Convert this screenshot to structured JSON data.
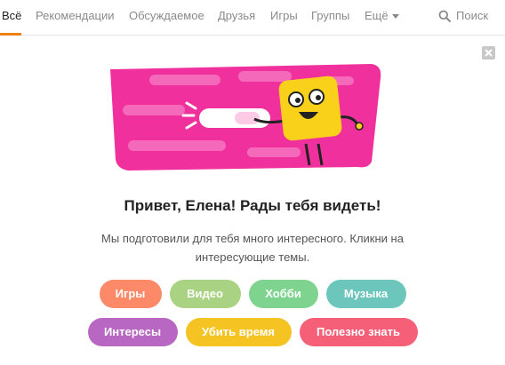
{
  "nav": {
    "tabs": [
      {
        "label": "Всё"
      },
      {
        "label": "Рекомендации"
      },
      {
        "label": "Обсуждаемое"
      },
      {
        "label": "Друзья"
      },
      {
        "label": "Игры"
      },
      {
        "label": "Группы"
      },
      {
        "label": "Ещё"
      }
    ],
    "active_tab": "Всё",
    "accent_color": "#ee8208",
    "search_label": "Поиск"
  },
  "banner": {
    "greeting": "Привет, Елена! Рады тебя видеть!",
    "description": "Мы подготовили для тебя много интересного. Кликни на интересующие темы.",
    "topics_row1": [
      {
        "label": "Игры",
        "color": "#fc8967"
      },
      {
        "label": "Видео",
        "color": "#a9d282"
      },
      {
        "label": "Хобби",
        "color": "#7ed48f"
      },
      {
        "label": "Музыка",
        "color": "#6cc6bb"
      }
    ],
    "topics_row2": [
      {
        "label": "Интересы",
        "color": "#b867c2"
      },
      {
        "label": "Убить время",
        "color": "#f5c423"
      },
      {
        "label": "Полезно знать",
        "color": "#f65f78"
      }
    ],
    "illustration_colors": {
      "ribbon": "#f0309c",
      "character": "#f9d11a"
    }
  }
}
